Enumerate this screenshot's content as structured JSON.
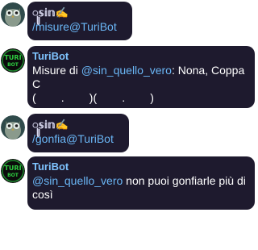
{
  "colors": {
    "bubble_bg": "#1e1a2e",
    "link": "#6ab6f5",
    "bot_name": "#7fc4ff",
    "text": "#ffffff"
  },
  "messages": [
    {
      "sender": "ꦸ𝕤𝕚𝕟✍",
      "avatar_icon": "owl-avatar-icon",
      "command": "/misure@TuriBot"
    },
    {
      "sender": "TuriBot",
      "avatar_icon": "turibot-logo-icon",
      "avatar_text": "TURI\nBOT",
      "text_before": "Misure di ",
      "mention": "@sin_quello_vero",
      "text_after": ": Nona, Coppa C",
      "line3": "(        .        )(        .        )"
    },
    {
      "sender": "ꦸ𝕤𝕚𝕟✍",
      "avatar_icon": "owl-avatar-icon",
      "command": "/gonfia@TuriBot"
    },
    {
      "sender": "TuriBot",
      "avatar_icon": "turibot-logo-icon",
      "avatar_text": "TURI\nBOT",
      "mention": "@sin_quello_vero",
      "text_after": " non puoi gonfiarle più di così"
    }
  ]
}
